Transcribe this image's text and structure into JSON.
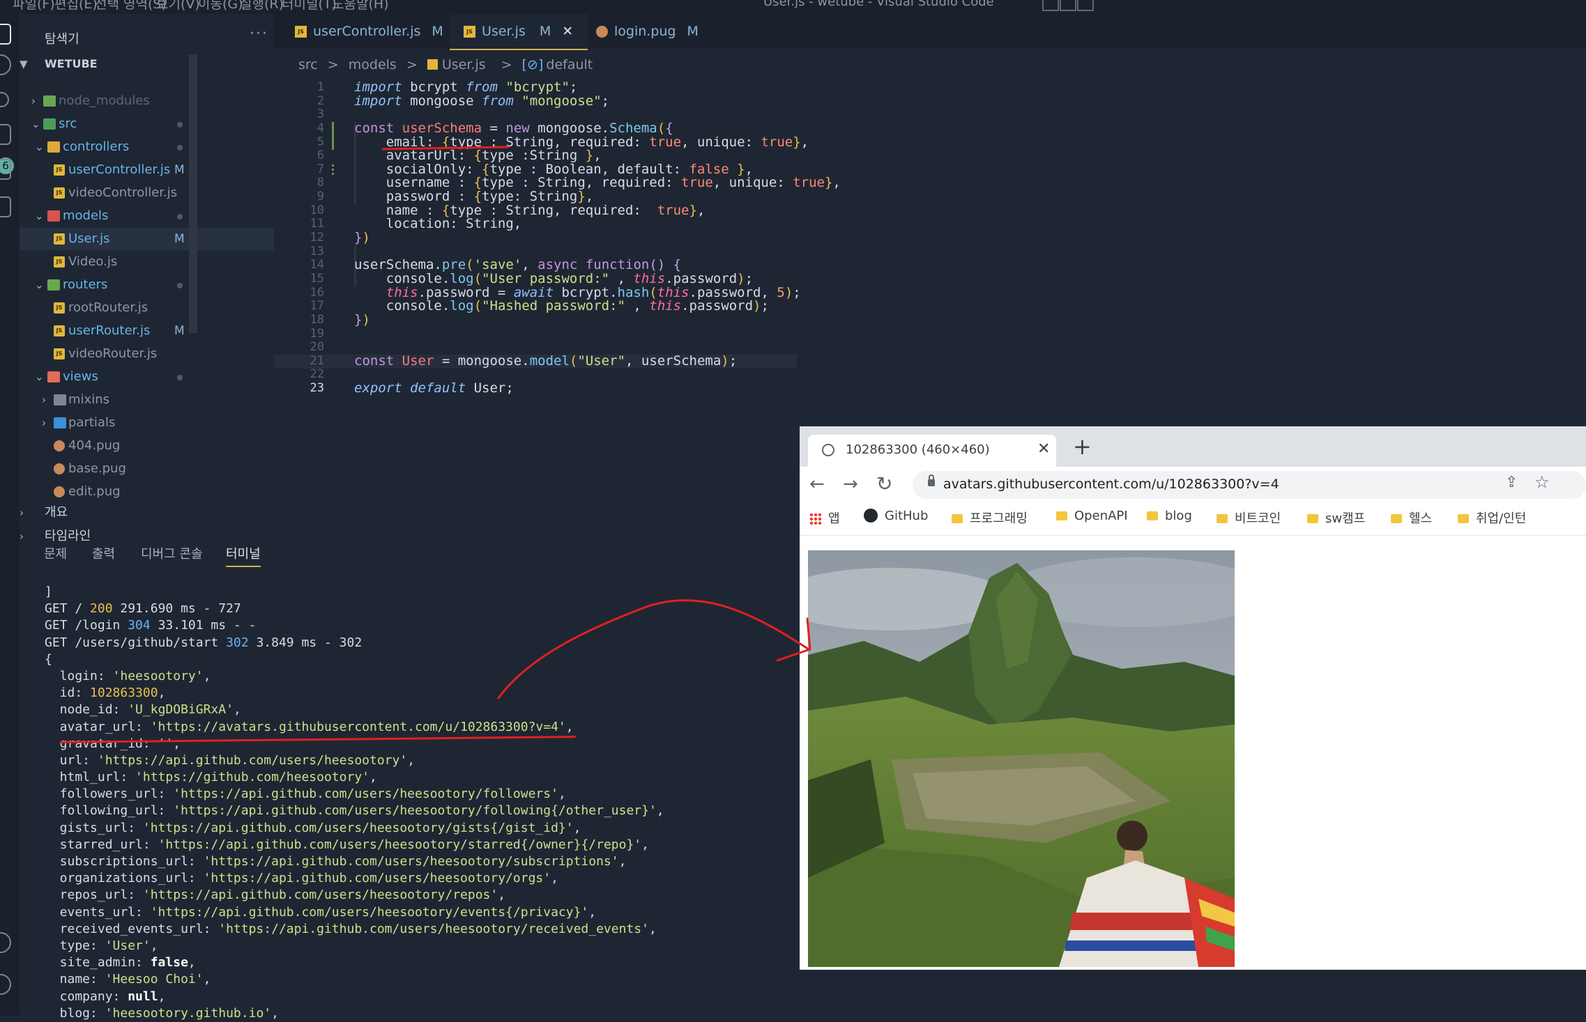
{
  "window": {
    "title": "User.js - wetube - Visual Studio Code",
    "menu": [
      "파일(F)",
      "편집(E)",
      "선택 영역(S)",
      "보기(V)",
      "이동(G)",
      "실행(R)",
      "터미널(T)",
      "도움말(H)"
    ]
  },
  "activity": {
    "badge": "6"
  },
  "explorer": {
    "title": "탐색기",
    "more": "···",
    "root": "WETUBE",
    "items": [
      {
        "label": "node_modules",
        "flag": ""
      },
      {
        "label": "src",
        "flag": ""
      },
      {
        "label": "controllers",
        "flag": ""
      },
      {
        "label": "userController.js",
        "flag": "M"
      },
      {
        "label": "videoController.js",
        "flag": ""
      },
      {
        "label": "models",
        "flag": ""
      },
      {
        "label": "User.js",
        "flag": "M"
      },
      {
        "label": "Video.js",
        "flag": ""
      },
      {
        "label": "routers",
        "flag": ""
      },
      {
        "label": "rootRouter.js",
        "flag": ""
      },
      {
        "label": "userRouter.js",
        "flag": "M"
      },
      {
        "label": "videoRouter.js",
        "flag": ""
      },
      {
        "label": "views",
        "flag": ""
      },
      {
        "label": "mixins",
        "flag": ""
      },
      {
        "label": "partials",
        "flag": ""
      },
      {
        "label": "404.pug",
        "flag": ""
      },
      {
        "label": "base.pug",
        "flag": ""
      },
      {
        "label": "edit.pug",
        "flag": ""
      }
    ],
    "outline": "개요",
    "timeline": "타임라인"
  },
  "tabs": [
    {
      "label": "userController.js",
      "flag": "M"
    },
    {
      "label": "User.js",
      "flag": "M",
      "close": "✕"
    },
    {
      "label": "login.pug",
      "flag": "M"
    }
  ],
  "breadcrumb": [
    "src",
    ">",
    "models",
    ">",
    "User.js",
    ">",
    "default"
  ],
  "editor": {
    "line_numbers": [
      "1",
      "2",
      "3",
      "4",
      "5",
      "6",
      "7",
      "8",
      "9",
      "10",
      "11",
      "12",
      "13",
      "14",
      "15",
      "16",
      "17",
      "18",
      "19",
      "20",
      "21",
      "22",
      "23"
    ]
  },
  "panel": {
    "tabs": [
      "문제",
      "출력",
      "디버그 콘솔",
      "터미널"
    ],
    "active_tab": "터미널"
  },
  "terminal": {
    "lines": [
      "]",
      "GET / 200 291.690 ms - 727",
      "GET /login 304 33.101 ms - -",
      "GET /users/github/start 302 3.849 ms - 302",
      "{",
      "  login: 'heesootory',",
      "  id: 102863300,",
      "  node_id: 'U_kgDOBiGRxA',",
      "  avatar_url: 'https://avatars.githubusercontent.com/u/102863300?v=4',",
      "  gravatar_id: '',",
      "  url: 'https://api.github.com/users/heesootory',",
      "  html_url: 'https://github.com/heesootory',",
      "  followers_url: 'https://api.github.com/users/heesootory/followers',",
      "  following_url: 'https://api.github.com/users/heesootory/following{/other_user}',",
      "  gists_url: 'https://api.github.com/users/heesootory/gists{/gist_id}',",
      "  starred_url: 'https://api.github.com/users/heesootory/starred{/owner}{/repo}',",
      "  subscriptions_url: 'https://api.github.com/users/heesootory/subscriptions',",
      "  organizations_url: 'https://api.github.com/users/heesootory/orgs',",
      "  repos_url: 'https://api.github.com/users/heesootory/repos',",
      "  events_url: 'https://api.github.com/users/heesootory/events{/privacy}',",
      "  received_events_url: 'https://api.github.com/users/heesootory/received_events',",
      "  type: 'User',",
      "  site_admin: false,",
      "  name: 'Heesoo Choi',",
      "  company: null,",
      "  blog: 'heesootory.github.io',"
    ]
  },
  "browser": {
    "tab_title": "102863300 (460×460)",
    "tab_close": "✕",
    "new_tab": "+",
    "url": "avatars.githubusercontent.com/u/102863300?v=4",
    "bookmarks": [
      "앱",
      "GitHub",
      "프로그래밍",
      "OpenAPI",
      "blog",
      "비트코인",
      "sw캠프",
      "헬스",
      "취업/인턴"
    ],
    "image_alt": "102863300"
  },
  "colors": {
    "accent": "#d3b14e",
    "annotation": "#e0211d"
  }
}
